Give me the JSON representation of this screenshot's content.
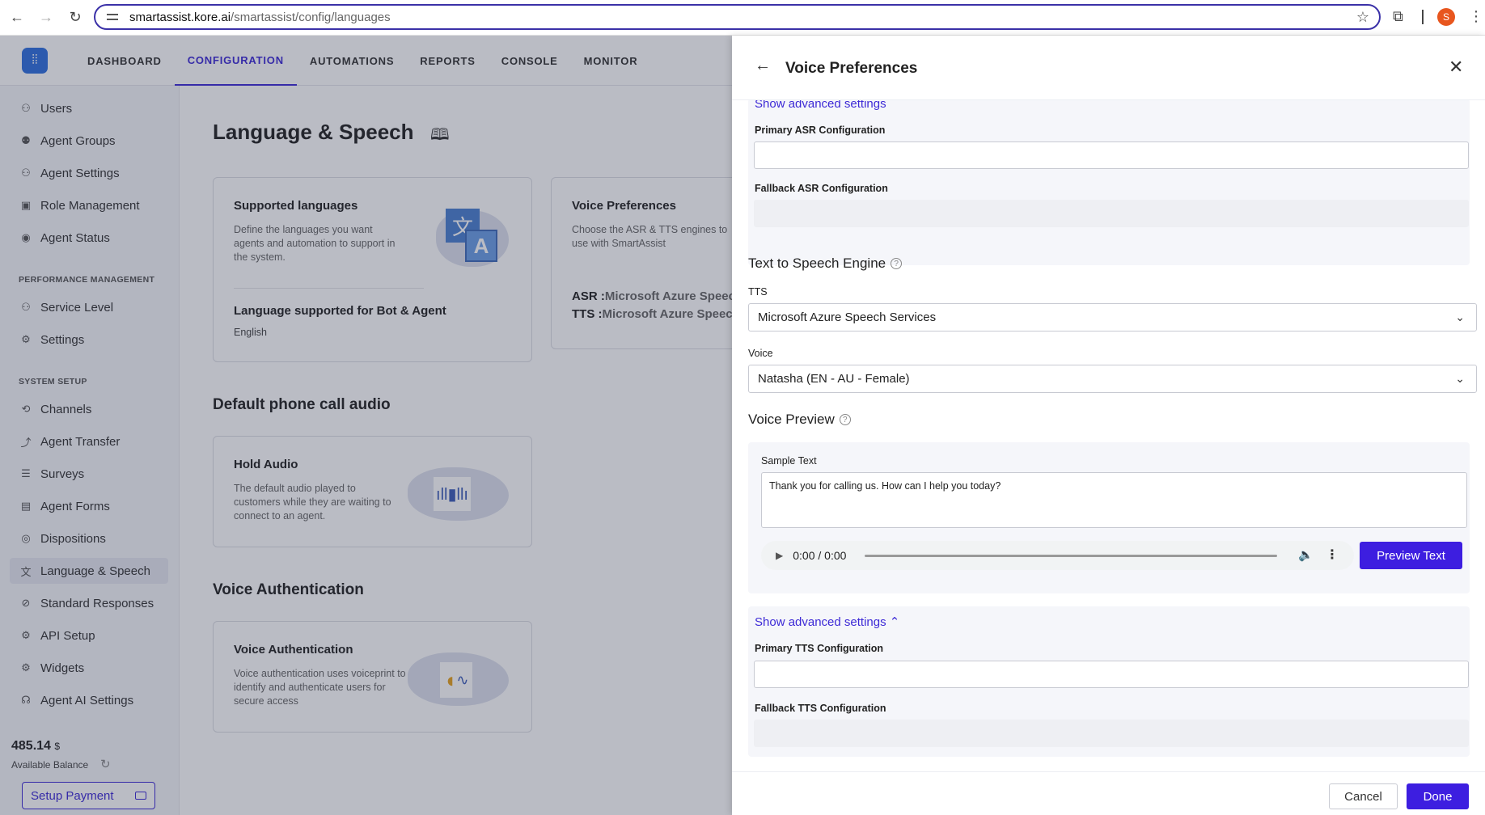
{
  "browser": {
    "url_host": "smartassist.kore.ai",
    "url_path": "/smartassist/config/languages",
    "profile_initial": "S"
  },
  "header": {
    "tabs": [
      {
        "label": "DASHBOARD"
      },
      {
        "label": "CONFIGURATION"
      },
      {
        "label": "AUTOMATIONS"
      },
      {
        "label": "REPORTS"
      },
      {
        "label": "CONSOLE"
      },
      {
        "label": "MONITOR"
      }
    ]
  },
  "sidebar": {
    "items_top": [
      {
        "label": "Users",
        "icon": "user-icon"
      },
      {
        "label": "Agent Groups",
        "icon": "group-icon"
      },
      {
        "label": "Agent Settings",
        "icon": "user-gear-icon"
      },
      {
        "label": "Role Management",
        "icon": "badge-icon"
      },
      {
        "label": "Agent Status",
        "icon": "signal-icon"
      }
    ],
    "section_performance": "PERFORMANCE MANAGEMENT",
    "items_perf": [
      {
        "label": "Service Level",
        "icon": "user-icon"
      },
      {
        "label": "Settings",
        "icon": "gear-icon"
      }
    ],
    "section_system": "SYSTEM SETUP",
    "items_system": [
      {
        "label": "Channels",
        "icon": "channels-icon"
      },
      {
        "label": "Agent Transfer",
        "icon": "transfer-icon"
      },
      {
        "label": "Surveys",
        "icon": "survey-icon"
      },
      {
        "label": "Agent Forms",
        "icon": "form-icon"
      },
      {
        "label": "Dispositions",
        "icon": "disposition-icon"
      },
      {
        "label": "Language & Speech",
        "icon": "language-icon"
      },
      {
        "label": "Standard Responses",
        "icon": "response-icon"
      },
      {
        "label": "API Setup",
        "icon": "api-icon"
      },
      {
        "label": "Widgets",
        "icon": "widget-icon"
      },
      {
        "label": "Agent AI Settings",
        "icon": "headset-icon"
      }
    ],
    "balance_value": "485.14",
    "balance_currency": "$",
    "balance_label": "Available Balance",
    "setup_payment": "Setup Payment"
  },
  "main": {
    "title": "Language & Speech",
    "supported_languages": {
      "title": "Supported languages",
      "desc": "Define the languages you want agents and automation to support in the system.",
      "bot_agent_title": "Language supported for Bot & Agent",
      "bot_agent_value": "English",
      "illus_char1": "文",
      "illus_char2": "A"
    },
    "voice_prefs_card": {
      "title": "Voice Preferences",
      "desc": "Choose the ASR & TTS engines to use with SmartAssist",
      "asr_label": "ASR :",
      "asr_value": "Microsoft Azure Speech",
      "tts_label": "TTS :",
      "tts_value": "Microsoft Azure Speech"
    },
    "default_audio_heading": "Default phone call audio",
    "hold_audio": {
      "title": "Hold Audio",
      "desc": "The default audio played to customers while they are waiting to connect to an agent."
    },
    "voice_auth_heading": "Voice Authentication",
    "voice_auth": {
      "title": "Voice Authentication",
      "desc": "Voice authentication uses voiceprint to identify and authenticate users for secure access"
    }
  },
  "panel": {
    "title": "Voice Preferences",
    "asr_advanced_link": "Show advanced settings",
    "primary_asr_label": "Primary ASR Configuration",
    "primary_asr_value": "",
    "fallback_asr_label": "Fallback ASR Configuration",
    "tts_section": "Text to Speech Engine",
    "tts_label": "TTS",
    "tts_value": "Microsoft Azure Speech Services",
    "voice_label": "Voice",
    "voice_value": "Natasha (EN - AU - Female)",
    "preview_section": "Voice Preview",
    "sample_text_label": "Sample Text",
    "sample_text_value": "Thank you for calling us. How can I help you today?",
    "player_time": "0:00 / 0:00",
    "preview_button": "Preview Text",
    "tts_advanced_link": "Show advanced settings",
    "primary_tts_label": "Primary TTS Configuration",
    "primary_tts_value": "",
    "fallback_tts_label": "Fallback TTS Configuration",
    "cancel": "Cancel",
    "done": "Done"
  }
}
